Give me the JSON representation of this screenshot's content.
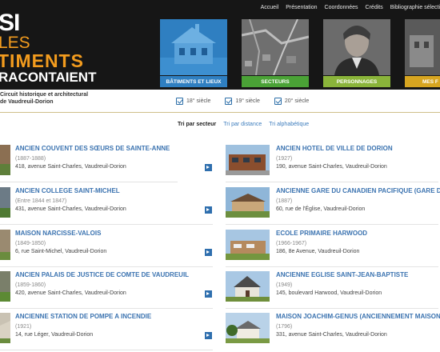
{
  "topnav": [
    "Accueil",
    "Présentation",
    "Coordonnées",
    "Crédits",
    "Bibliographie sélecti"
  ],
  "logo": {
    "line1": "SI",
    "line2": "LES",
    "line3": "TIMENTS",
    "line4": "RACONTAIENT"
  },
  "tiles": [
    {
      "label": "BÂTIMENTS ET LIEUX",
      "color": "#2f7fc1"
    },
    {
      "label": "SECTEURS",
      "color": "#4aa236"
    },
    {
      "label": "PERSONNAGES",
      "color": "#8ab43a"
    },
    {
      "label": "MES F",
      "color": "#d7a520"
    }
  ],
  "subtitle": {
    "line1": "Circuit historique et architectural",
    "line2": "de Vaudreuil-Dorion"
  },
  "filters": [
    "18° siècle",
    "19° siècle",
    "20° siècle"
  ],
  "sort": {
    "active": "Tri par secteur",
    "distance": "Tri par distance",
    "alpha": "Tri alphabétique"
  },
  "left_items": [
    {
      "title": "ANCIEN COUVENT DES SŒURS DE SAINTE-ANNE",
      "year": "(1887-1888)",
      "address": "418, avenue Saint-Charles, Vaudreuil-Dorion"
    },
    {
      "title": "ANCIEN COLLEGE SAINT-MICHEL",
      "year": "(Entre 1844 et 1847)",
      "address": "431, avenue Saint-Charles, Vaudreuil-Dorion"
    },
    {
      "title": "MAISON NARCISSE-VALOIS",
      "year": "(1849-1850)",
      "address": "6, rue Saint-Michel, Vaudreuil-Dorion"
    },
    {
      "title": "ANCIEN PALAIS DE JUSTICE DE COMTE DE VAUDREUIL",
      "year": "(1859-1860)",
      "address": "420, avenue Saint-Charles, Vaudreuil-Dorion"
    },
    {
      "title": "ANCIENNE STATION DE POMPE A INCENDIE",
      "year": "(1921)",
      "address": "14, rue Léger, Vaudreuil-Dorion"
    }
  ],
  "right_items": [
    {
      "title": "ANCIEN HOTEL DE VILLE DE DORION",
      "year": "(1927)",
      "address": "190, avenue Saint-Charles, Vaudreuil-Dorion"
    },
    {
      "title": "ANCIENNE GARE DU CANADIEN PACIFIQUE (GARE DOR",
      "year": "(1887)",
      "address": "60, rue de l'Église, Vaudreuil-Dorion"
    },
    {
      "title": "ECOLE PRIMAIRE HARWOOD",
      "year": "(1966-1967)",
      "address": "186, 8e Avenue, Vaudreuil-Dorion"
    },
    {
      "title": "ANCIENNE EGLISE SAINT-JEAN-BAPTISTE",
      "year": "(1949)",
      "address": "145, boulevard Harwood, Vaudreuil-Dorion"
    },
    {
      "title": "MAISON JOACHIM-GENUS (ANCIENNEMENT MAISON V",
      "year": "(1796)",
      "address": "331, avenue Saint-Charles, Vaudreuil-Dorion"
    }
  ]
}
